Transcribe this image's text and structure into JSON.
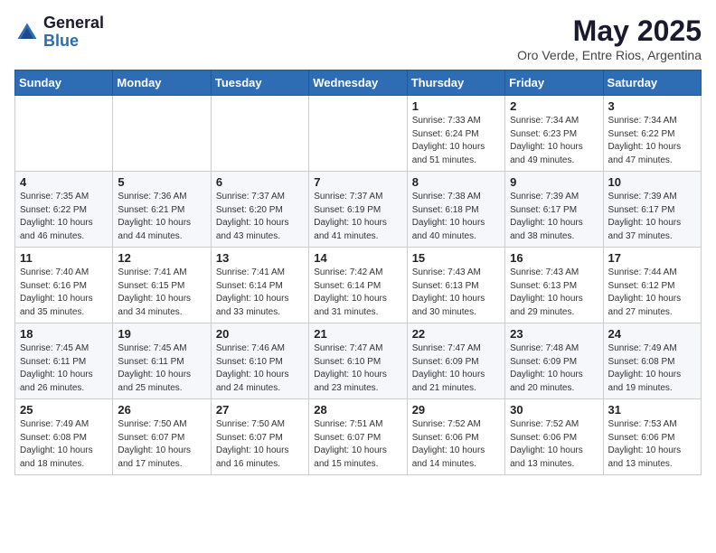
{
  "header": {
    "logo_line1": "General",
    "logo_line2": "Blue",
    "month_title": "May 2025",
    "subtitle": "Oro Verde, Entre Rios, Argentina"
  },
  "days_of_week": [
    "Sunday",
    "Monday",
    "Tuesday",
    "Wednesday",
    "Thursday",
    "Friday",
    "Saturday"
  ],
  "weeks": [
    [
      {
        "day": "",
        "info": ""
      },
      {
        "day": "",
        "info": ""
      },
      {
        "day": "",
        "info": ""
      },
      {
        "day": "",
        "info": ""
      },
      {
        "day": "1",
        "info": "Sunrise: 7:33 AM\nSunset: 6:24 PM\nDaylight: 10 hours\nand 51 minutes."
      },
      {
        "day": "2",
        "info": "Sunrise: 7:34 AM\nSunset: 6:23 PM\nDaylight: 10 hours\nand 49 minutes."
      },
      {
        "day": "3",
        "info": "Sunrise: 7:34 AM\nSunset: 6:22 PM\nDaylight: 10 hours\nand 47 minutes."
      }
    ],
    [
      {
        "day": "4",
        "info": "Sunrise: 7:35 AM\nSunset: 6:22 PM\nDaylight: 10 hours\nand 46 minutes."
      },
      {
        "day": "5",
        "info": "Sunrise: 7:36 AM\nSunset: 6:21 PM\nDaylight: 10 hours\nand 44 minutes."
      },
      {
        "day": "6",
        "info": "Sunrise: 7:37 AM\nSunset: 6:20 PM\nDaylight: 10 hours\nand 43 minutes."
      },
      {
        "day": "7",
        "info": "Sunrise: 7:37 AM\nSunset: 6:19 PM\nDaylight: 10 hours\nand 41 minutes."
      },
      {
        "day": "8",
        "info": "Sunrise: 7:38 AM\nSunset: 6:18 PM\nDaylight: 10 hours\nand 40 minutes."
      },
      {
        "day": "9",
        "info": "Sunrise: 7:39 AM\nSunset: 6:17 PM\nDaylight: 10 hours\nand 38 minutes."
      },
      {
        "day": "10",
        "info": "Sunrise: 7:39 AM\nSunset: 6:17 PM\nDaylight: 10 hours\nand 37 minutes."
      }
    ],
    [
      {
        "day": "11",
        "info": "Sunrise: 7:40 AM\nSunset: 6:16 PM\nDaylight: 10 hours\nand 35 minutes."
      },
      {
        "day": "12",
        "info": "Sunrise: 7:41 AM\nSunset: 6:15 PM\nDaylight: 10 hours\nand 34 minutes."
      },
      {
        "day": "13",
        "info": "Sunrise: 7:41 AM\nSunset: 6:14 PM\nDaylight: 10 hours\nand 33 minutes."
      },
      {
        "day": "14",
        "info": "Sunrise: 7:42 AM\nSunset: 6:14 PM\nDaylight: 10 hours\nand 31 minutes."
      },
      {
        "day": "15",
        "info": "Sunrise: 7:43 AM\nSunset: 6:13 PM\nDaylight: 10 hours\nand 30 minutes."
      },
      {
        "day": "16",
        "info": "Sunrise: 7:43 AM\nSunset: 6:13 PM\nDaylight: 10 hours\nand 29 minutes."
      },
      {
        "day": "17",
        "info": "Sunrise: 7:44 AM\nSunset: 6:12 PM\nDaylight: 10 hours\nand 27 minutes."
      }
    ],
    [
      {
        "day": "18",
        "info": "Sunrise: 7:45 AM\nSunset: 6:11 PM\nDaylight: 10 hours\nand 26 minutes."
      },
      {
        "day": "19",
        "info": "Sunrise: 7:45 AM\nSunset: 6:11 PM\nDaylight: 10 hours\nand 25 minutes."
      },
      {
        "day": "20",
        "info": "Sunrise: 7:46 AM\nSunset: 6:10 PM\nDaylight: 10 hours\nand 24 minutes."
      },
      {
        "day": "21",
        "info": "Sunrise: 7:47 AM\nSunset: 6:10 PM\nDaylight: 10 hours\nand 23 minutes."
      },
      {
        "day": "22",
        "info": "Sunrise: 7:47 AM\nSunset: 6:09 PM\nDaylight: 10 hours\nand 21 minutes."
      },
      {
        "day": "23",
        "info": "Sunrise: 7:48 AM\nSunset: 6:09 PM\nDaylight: 10 hours\nand 20 minutes."
      },
      {
        "day": "24",
        "info": "Sunrise: 7:49 AM\nSunset: 6:08 PM\nDaylight: 10 hours\nand 19 minutes."
      }
    ],
    [
      {
        "day": "25",
        "info": "Sunrise: 7:49 AM\nSunset: 6:08 PM\nDaylight: 10 hours\nand 18 minutes."
      },
      {
        "day": "26",
        "info": "Sunrise: 7:50 AM\nSunset: 6:07 PM\nDaylight: 10 hours\nand 17 minutes."
      },
      {
        "day": "27",
        "info": "Sunrise: 7:50 AM\nSunset: 6:07 PM\nDaylight: 10 hours\nand 16 minutes."
      },
      {
        "day": "28",
        "info": "Sunrise: 7:51 AM\nSunset: 6:07 PM\nDaylight: 10 hours\nand 15 minutes."
      },
      {
        "day": "29",
        "info": "Sunrise: 7:52 AM\nSunset: 6:06 PM\nDaylight: 10 hours\nand 14 minutes."
      },
      {
        "day": "30",
        "info": "Sunrise: 7:52 AM\nSunset: 6:06 PM\nDaylight: 10 hours\nand 13 minutes."
      },
      {
        "day": "31",
        "info": "Sunrise: 7:53 AM\nSunset: 6:06 PM\nDaylight: 10 hours\nand 13 minutes."
      }
    ]
  ]
}
